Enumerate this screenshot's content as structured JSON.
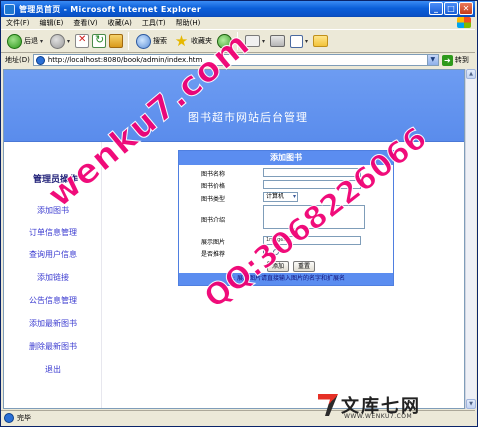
{
  "window": {
    "title": "管理员首页 - Microsoft Internet Explorer"
  },
  "menubar": {
    "items": [
      "文件(F)",
      "编辑(E)",
      "查看(V)",
      "收藏(A)",
      "工具(T)",
      "帮助(H)"
    ]
  },
  "toolbar": {
    "back_label": "后退",
    "search_label": "搜索",
    "favorites_label": "收藏夹"
  },
  "address": {
    "label": "地址(D)",
    "url": "http://localhost:8080/book/admin/index.htm",
    "go_label": "转到"
  },
  "banner": {
    "title": "图书超市网站后台管理"
  },
  "sidebar": {
    "heading": "管理员操作",
    "items": [
      "添加图书",
      "订单信息管理",
      "查询用户信息",
      "添加链接",
      "公告信息管理",
      "添加最新图书",
      "删除最新图书",
      "退出"
    ]
  },
  "form": {
    "title": "添加图书",
    "fields": {
      "name_label": "图书名称",
      "price_label": "图书价格",
      "category_label": "图书类型",
      "category_value": "计算机",
      "intro_label": "图书介绍",
      "image_label": "展示图片",
      "image_value": "1mages/",
      "recommend_label": "是否推荐"
    },
    "add_button": "添加",
    "reset_button": "重置",
    "footer_note": "注: 展示图片请直接输入图片的名字和扩展名"
  },
  "status": {
    "text": "完毕"
  },
  "watermark": {
    "text1": "wenku7.com",
    "text2": "QQ:3068226066",
    "brand": "文库七网",
    "brand_url": "WWW.WENKU7.COM"
  }
}
